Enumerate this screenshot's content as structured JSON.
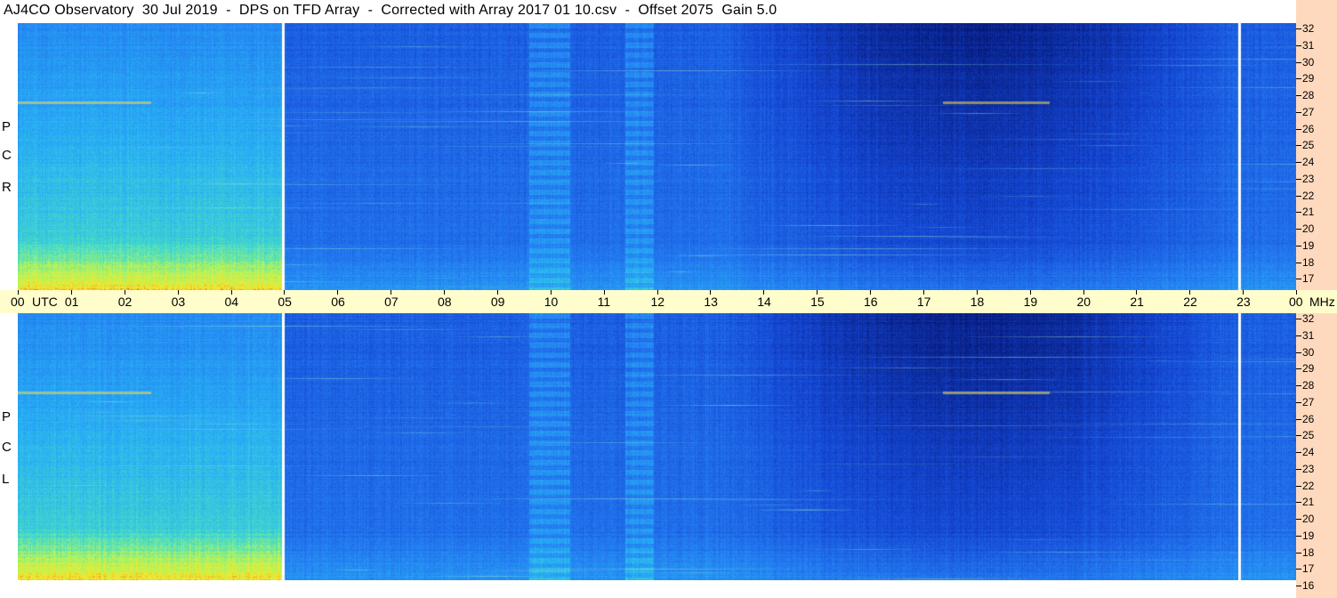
{
  "title": "AJ4CO Observatory  30 Jul 2019  -  DPS on TFD Array  -  Corrected with Array 2017 01 10.csv  -  Offset 2075  Gain 5.0",
  "panels": [
    {
      "id": "rcp",
      "pol_letters": [
        "P",
        "C",
        "R"
      ]
    },
    {
      "id": "lcp",
      "pol_letters": [
        "P",
        "C",
        "L"
      ]
    }
  ],
  "time_axis": {
    "hours": [
      "00",
      "01",
      "02",
      "03",
      "04",
      "05",
      "06",
      "07",
      "08",
      "09",
      "10",
      "11",
      "12",
      "13",
      "14",
      "15",
      "16",
      "17",
      "18",
      "19",
      "20",
      "21",
      "22",
      "23",
      "00"
    ],
    "utc_label": "UTC",
    "unit_label": "MHz"
  },
  "freq_axis": {
    "labels": [
      "32",
      "31",
      "30",
      "29",
      "28",
      "27",
      "26",
      "25",
      "24",
      "23",
      "22",
      "21",
      "20",
      "19",
      "18",
      "17",
      "16"
    ],
    "max_mhz": 32,
    "min_mhz": 16
  },
  "colors": {
    "title_bg": "#ffffff",
    "axis_bg": "#fffdcc",
    "scale_bg": "#ffd9bd",
    "gap_line": "#ffffff"
  }
}
